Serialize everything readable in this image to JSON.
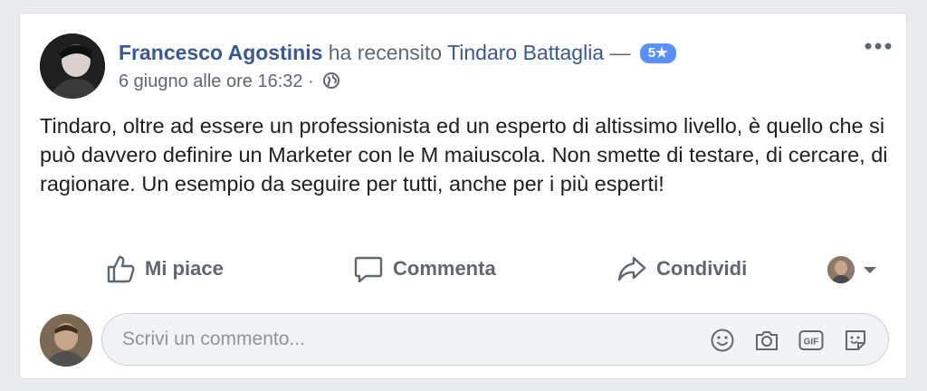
{
  "post": {
    "author": "Francesco Agostinis",
    "action_text": "ha recensito",
    "page_name": "Tindaro Battaglia",
    "separator": "—",
    "rating_badge": "5★",
    "timestamp": "6 giugno alle ore 16:32",
    "dot": "·",
    "privacy_icon": "globe-icon",
    "body": "Tindaro, oltre ad essere un professionista ed un esperto di altissimo livello, è quello che si può davvero definire un Marketer con le M maiuscola. Non smette di testare, di cercare, di ragionare. Un esempio da seguire per tutti, anche per i più esperti!"
  },
  "actions": {
    "like_label": "Mi piace",
    "comment_label": "Commenta",
    "share_label": "Condividi"
  },
  "comment": {
    "placeholder": "Scrivi un commento...",
    "icons": [
      "emoji-icon",
      "camera-icon",
      "gif-icon",
      "sticker-icon"
    ]
  },
  "colors": {
    "link": "#385898",
    "badge": "#5890ff",
    "secondary_text": "#606770",
    "body_text": "#1c1e21",
    "background": "#e9ebee"
  }
}
